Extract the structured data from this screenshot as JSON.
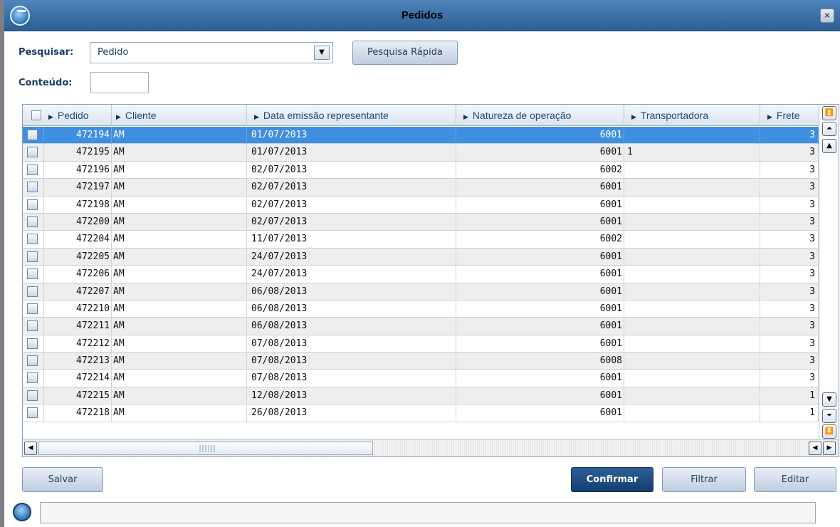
{
  "window": {
    "title": "Pedidos",
    "close_label": "×"
  },
  "form": {
    "search_label": "Pesquisar:",
    "search_value": "Pedido",
    "quick_search_label": "Pesquisa Rápida",
    "content_label": "Conteúdo:",
    "content_value": ""
  },
  "grid": {
    "columns": [
      "Pedido",
      "Cliente",
      "Data emissão representante",
      "Natureza de operação",
      "Transportadora",
      "Frete"
    ],
    "rows": [
      {
        "pedido": "472194",
        "cliente": "AM",
        "data": "01/07/2013",
        "natureza": "6001",
        "transportadora": "",
        "frete": "3",
        "selected": true
      },
      {
        "pedido": "472195",
        "cliente": "AM",
        "data": "01/07/2013",
        "natureza": "6001",
        "transportadora": "1",
        "frete": "3"
      },
      {
        "pedido": "472196",
        "cliente": "AM",
        "data": "02/07/2013",
        "natureza": "6002",
        "transportadora": "",
        "frete": "3"
      },
      {
        "pedido": "472197",
        "cliente": "AM",
        "data": "02/07/2013",
        "natureza": "6001",
        "transportadora": "",
        "frete": "3"
      },
      {
        "pedido": "472198",
        "cliente": "AM",
        "data": "02/07/2013",
        "natureza": "6001",
        "transportadora": "",
        "frete": "3"
      },
      {
        "pedido": "472200",
        "cliente": "AM",
        "data": "02/07/2013",
        "natureza": "6001",
        "transportadora": "",
        "frete": "3"
      },
      {
        "pedido": "472204",
        "cliente": "AM",
        "data": "11/07/2013",
        "natureza": "6002",
        "transportadora": "",
        "frete": "3"
      },
      {
        "pedido": "472205",
        "cliente": "AM",
        "data": "24/07/2013",
        "natureza": "6001",
        "transportadora": "",
        "frete": "3"
      },
      {
        "pedido": "472206",
        "cliente": "AM",
        "data": "24/07/2013",
        "natureza": "6001",
        "transportadora": "",
        "frete": "3"
      },
      {
        "pedido": "472207",
        "cliente": "AM",
        "data": "06/08/2013",
        "natureza": "6001",
        "transportadora": "",
        "frete": "3"
      },
      {
        "pedido": "472210",
        "cliente": "AM",
        "data": "06/08/2013",
        "natureza": "6001",
        "transportadora": "",
        "frete": "3"
      },
      {
        "pedido": "472211",
        "cliente": "AM",
        "data": "06/08/2013",
        "natureza": "6001",
        "transportadora": "",
        "frete": "3"
      },
      {
        "pedido": "472212",
        "cliente": "AM",
        "data": "07/08/2013",
        "natureza": "6001",
        "transportadora": "",
        "frete": "3"
      },
      {
        "pedido": "472213",
        "cliente": "AM",
        "data": "07/08/2013",
        "natureza": "6008",
        "transportadora": "",
        "frete": "3"
      },
      {
        "pedido": "472214",
        "cliente": "AM",
        "data": "07/08/2013",
        "natureza": "6001",
        "transportadora": "",
        "frete": "3"
      },
      {
        "pedido": "472215",
        "cliente": "AM",
        "data": "12/08/2013",
        "natureza": "6001",
        "transportadora": "",
        "frete": "1"
      },
      {
        "pedido": "472218",
        "cliente": "AM",
        "data": "26/08/2013",
        "natureza": "6001",
        "transportadora": "",
        "frete": "1"
      }
    ]
  },
  "buttons": {
    "save": "Salvar",
    "confirm": "Confirmar",
    "filter": "Filtrar",
    "edit": "Editar"
  },
  "status": {
    "text": ""
  },
  "colors": {
    "title_bar": "#3a6ea5",
    "selected_row": "#3f8fe0",
    "primary_button": "#1d4a7e",
    "alt_row": "#eeeeee"
  },
  "icons": [
    "app-logo-icon",
    "close-icon",
    "dropdown-arrow-icon",
    "scroll-top-icon",
    "scroll-page-up-icon",
    "scroll-up-icon",
    "scroll-down-icon",
    "scroll-page-down-icon",
    "scroll-bottom-icon",
    "scroll-left-icon",
    "scroll-right-icon"
  ]
}
